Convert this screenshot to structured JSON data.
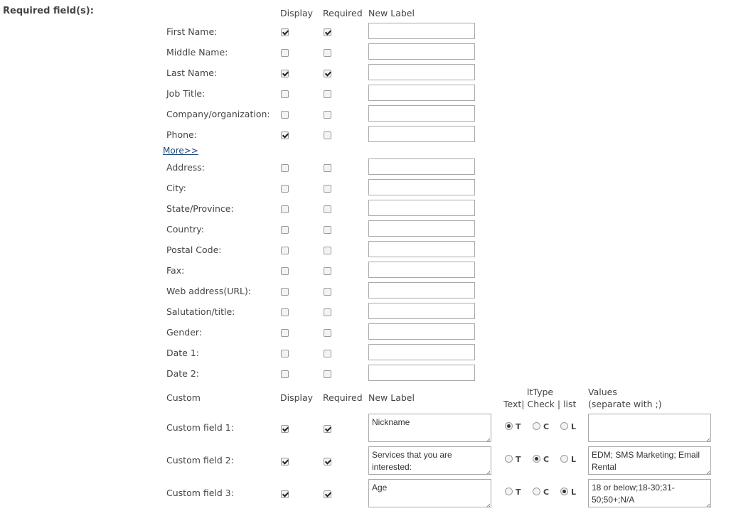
{
  "section_title": "Required field(s):",
  "headers": {
    "display": "Display",
    "required": "Required",
    "new_label": "New Label"
  },
  "fields": [
    {
      "label": "First Name:",
      "display": true,
      "required": true,
      "new_label": ""
    },
    {
      "label": "Middle Name:",
      "display": false,
      "required": false,
      "new_label": ""
    },
    {
      "label": "Last Name:",
      "display": true,
      "required": true,
      "new_label": ""
    },
    {
      "label": "Job Title:",
      "display": false,
      "required": false,
      "new_label": ""
    },
    {
      "label": "Company/organization:",
      "display": false,
      "required": false,
      "new_label": ""
    },
    {
      "label": "Phone:",
      "display": true,
      "required": false,
      "new_label": ""
    }
  ],
  "more_link": "More>>",
  "more_fields": [
    {
      "label": "Address:",
      "display": false,
      "required": false,
      "new_label": ""
    },
    {
      "label": "City:",
      "display": false,
      "required": false,
      "new_label": ""
    },
    {
      "label": "State/Province:",
      "display": false,
      "required": false,
      "new_label": ""
    },
    {
      "label": "Country:",
      "display": false,
      "required": false,
      "new_label": ""
    },
    {
      "label": "Postal Code:",
      "display": false,
      "required": false,
      "new_label": ""
    },
    {
      "label": "Fax:",
      "display": false,
      "required": false,
      "new_label": ""
    },
    {
      "label": "Web address(URL):",
      "display": false,
      "required": false,
      "new_label": ""
    },
    {
      "label": "Salutation/title:",
      "display": false,
      "required": false,
      "new_label": ""
    },
    {
      "label": "Gender:",
      "display": false,
      "required": false,
      "new_label": ""
    },
    {
      "label": "Date 1:",
      "display": false,
      "required": false,
      "new_label": ""
    },
    {
      "label": "Date 2:",
      "display": false,
      "required": false,
      "new_label": ""
    }
  ],
  "custom_headers": {
    "custom": "Custom",
    "display": "Display",
    "required": "Required",
    "new_label": "New Label",
    "type_title": "ltType",
    "type_options": "Text| Check | list",
    "values_title": "Values",
    "values_hint": "(separate with ;)"
  },
  "type_letters": {
    "text": "T",
    "check": "C",
    "list": "L"
  },
  "custom_fields": [
    {
      "label": "Custom field 1:",
      "display": true,
      "required": true,
      "new_label": "Nickname",
      "type": "T",
      "values": ""
    },
    {
      "label": "Custom field 2:",
      "display": true,
      "required": true,
      "new_label": "Services that you are interested:",
      "type": "C",
      "values": "EDM; SMS Marketing; Email Rental"
    },
    {
      "label": "Custom field 3:",
      "display": true,
      "required": true,
      "new_label": "Age",
      "type": "L",
      "values": "18 or below;18-30;31-50;50+;N/A"
    }
  ]
}
